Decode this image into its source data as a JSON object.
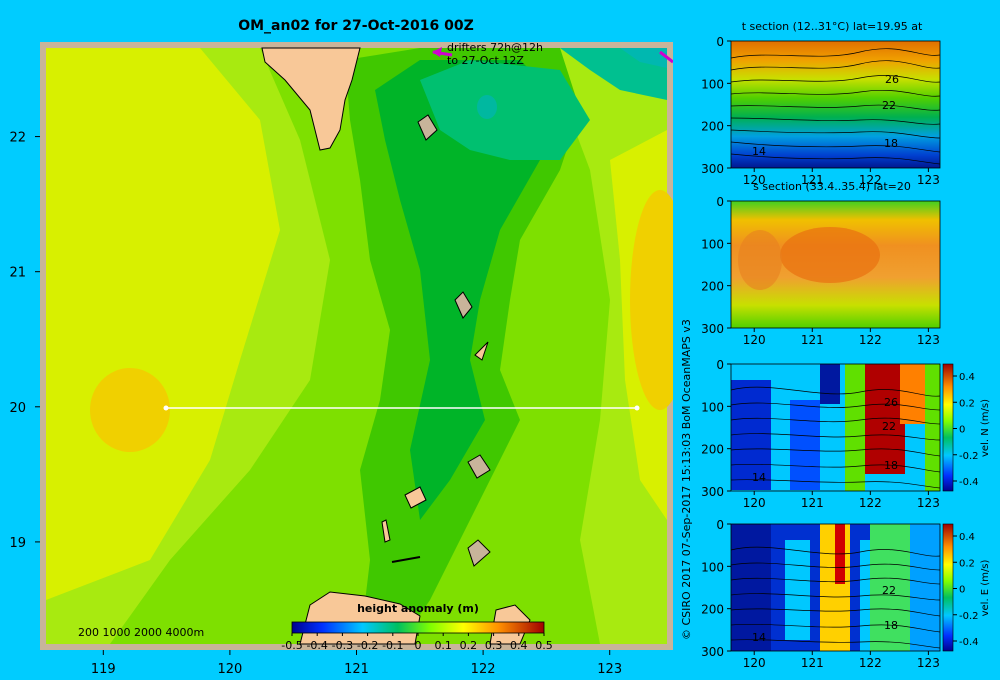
{
  "background_color": "#00ccff",
  "chart_data": [
    {
      "id": "map",
      "type": "heatmap",
      "title": "OM_an02 for 27-Oct-2016 00Z",
      "x_ticks": [
        "119",
        "120",
        "121",
        "122",
        "123"
      ],
      "y_ticks": [
        "22",
        "21",
        "20",
        "19"
      ],
      "xlim": [
        118.5,
        123.5
      ],
      "ylim": [
        18.2,
        22.7
      ],
      "section_line": {
        "lat": 20.0,
        "lon_start": 119.5,
        "lon_end": 123.2
      },
      "drifter_note": [
        "drifters 72h@12h",
        "to 27-Oct 12Z"
      ],
      "depth_legend": "200  1000  2000  4000m",
      "colorbar": {
        "label": "height anomaly  (m)",
        "ticks": [
          "-0.5",
          "-0.4",
          "-0.3",
          "-0.2",
          "-0.1",
          "0",
          "0.1",
          "0.2",
          "0.3",
          "0.4",
          "0.5"
        ],
        "range": [
          -0.5,
          0.5
        ]
      }
    },
    {
      "id": "t_section",
      "type": "heatmap",
      "title": "t section (12..31°C) lat=19.95 at",
      "x_ticks": [
        "120",
        "121",
        "122",
        "123"
      ],
      "y_ticks": [
        "0",
        "100",
        "200",
        "300"
      ],
      "contour_labels": [
        "26",
        "22",
        "18",
        "14"
      ]
    },
    {
      "id": "s_section",
      "type": "heatmap",
      "title": "s section (33.4..35.4) lat=20",
      "x_ticks": [
        "120",
        "121",
        "122",
        "123"
      ],
      "y_ticks": [
        "0",
        "100",
        "200",
        "300"
      ]
    },
    {
      "id": "vn_section",
      "type": "heatmap",
      "x_ticks": [
        "120",
        "121",
        "122",
        "123"
      ],
      "y_ticks": [
        "0",
        "100",
        "200",
        "300"
      ],
      "contour_labels": [
        "26",
        "22",
        "18",
        "14"
      ],
      "colorbar": {
        "label": "vel. N  (m/s)",
        "ticks": [
          "0.4",
          "0.2",
          "0",
          "-0.2",
          "-0.4"
        ]
      }
    },
    {
      "id": "ve_section",
      "type": "heatmap",
      "x_ticks": [
        "120",
        "121",
        "122",
        "123"
      ],
      "y_ticks": [
        "0",
        "100",
        "200",
        "300"
      ],
      "contour_labels": [
        "22",
        "18",
        "14"
      ],
      "colorbar": {
        "label": "vel. E  (m/s)",
        "ticks": [
          "0.4",
          "0.2",
          "0",
          "-0.2",
          "-0.4"
        ]
      }
    }
  ],
  "credit": "© CSIRO 2017   07-Sep-2017 15:13:03 BoM OceanMAPS v3"
}
